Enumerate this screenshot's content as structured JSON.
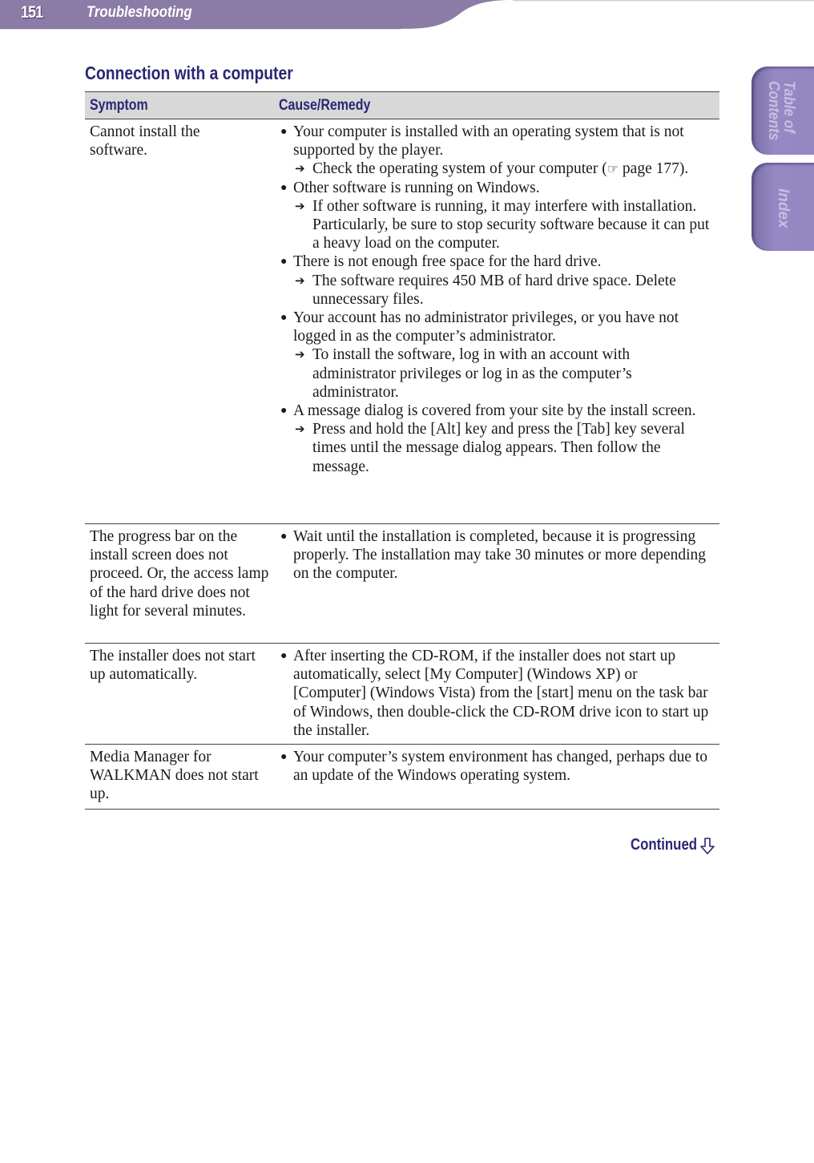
{
  "header": {
    "page_number": "151",
    "running_title": "Troubleshooting",
    "band_color": "#8a7ca6"
  },
  "side_tabs": [
    {
      "label": "Table of\nContents"
    },
    {
      "label": "Index"
    }
  ],
  "section": {
    "title": "Connection with a computer"
  },
  "table": {
    "headers": {
      "symptom": "Symptom",
      "cause": "Cause/Remedy"
    },
    "rows": [
      {
        "symptom": "Cannot install the software.",
        "items": [
          {
            "text": "Your computer is installed with an operating system that is not supported by the player.",
            "remedies": [
              {
                "text_before": "Check the operating system of your computer (",
                "ref_icon": "pointing-hand-icon",
                "text_after": " page 177)."
              }
            ]
          },
          {
            "text": "Other software is running on Windows.",
            "remedies": [
              {
                "text": "If other software is running, it may interfere with installation. Particularly, be sure to stop security software because it can put a heavy load on the computer."
              }
            ]
          },
          {
            "text": "There is not enough free space for the hard drive.",
            "remedies": [
              {
                "text": "The software requires 450 MB of hard drive space. Delete unnecessary files."
              }
            ]
          },
          {
            "text": "Your account has no administrator privileges, or you have not logged in as the computer’s administrator.",
            "remedies": [
              {
                "text": "To install the software, log in with an account with administrator privileges or log in as the computer’s administrator."
              }
            ]
          },
          {
            "text": "A message dialog is covered from your site by the install screen.",
            "remedies": [
              {
                "text": "Press and hold the [Alt] key and press the [Tab] key several times until the message dialog appears. Then follow the message."
              }
            ]
          }
        ]
      },
      {
        "symptom": "The progress bar on the install screen does not proceed. Or, the access lamp of the hard drive does not light for several minutes.",
        "items": [
          {
            "text": "Wait until the installation is completed, because it is progressing properly. The installation may take 30 minutes or more depending on the computer."
          }
        ]
      },
      {
        "symptom": "The installer does not start up automatically.",
        "items": [
          {
            "text": "After inserting the CD-ROM, if the installer does not start up automatically, select [My Computer] (Windows XP) or [Computer] (Windows Vista) from the [start] menu on the task bar of Windows, then double-click the CD-ROM drive icon to start up the installer."
          }
        ]
      },
      {
        "symptom": "Media Manager for WALKMAN does not start up.",
        "items": [
          {
            "text": "Your computer’s system environment has changed, perhaps due to an update of the Windows operating system."
          }
        ]
      }
    ]
  },
  "footer": {
    "continued_label": "Continued",
    "accent_color": "#2b2774"
  },
  "glyphs": {
    "bullet": "●",
    "arrow": "➔",
    "ref": "☞"
  }
}
